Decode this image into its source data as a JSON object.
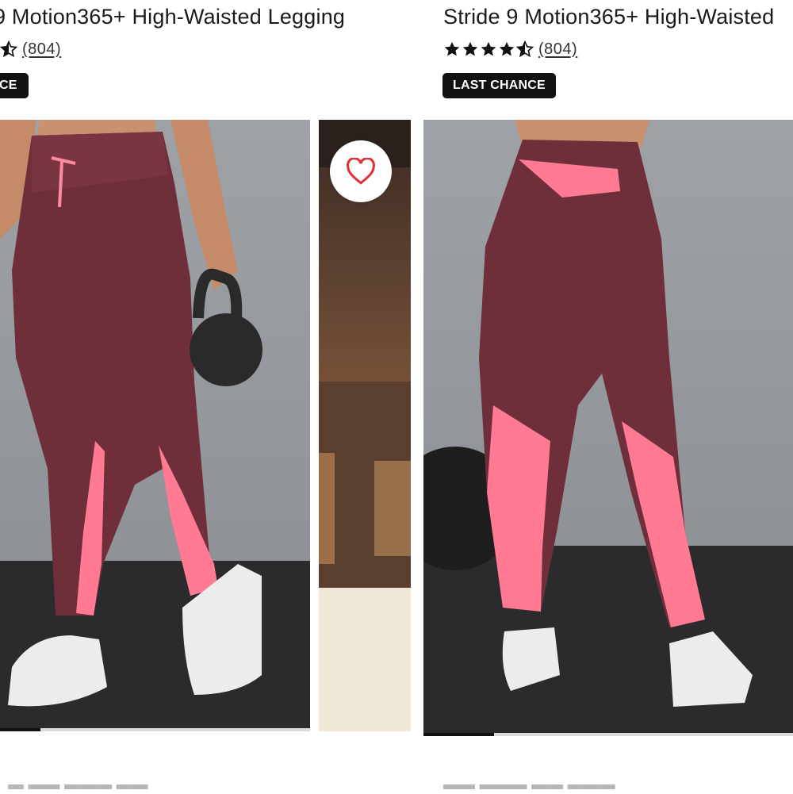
{
  "products": [
    {
      "title": "9 Motion365+ High-Waisted Legging",
      "rating_count": "(804)",
      "rating_value": 4.5,
      "badge": "CE",
      "image_progress": 0.13
    },
    {
      "title": "Stride 9 Motion365+ High-Waisted",
      "rating_count": "(804)",
      "rating_value": 4.5,
      "badge": "LAST CHANCE",
      "image_progress": 0.19
    }
  ],
  "icons": {
    "favorite": "heart-outline-icon",
    "star": "star-icon"
  },
  "colors": {
    "badge_bg": "#111111",
    "legging_main": "#6e2f3a",
    "legging_accent": "#ff7a92",
    "heart": "#e0303a"
  }
}
